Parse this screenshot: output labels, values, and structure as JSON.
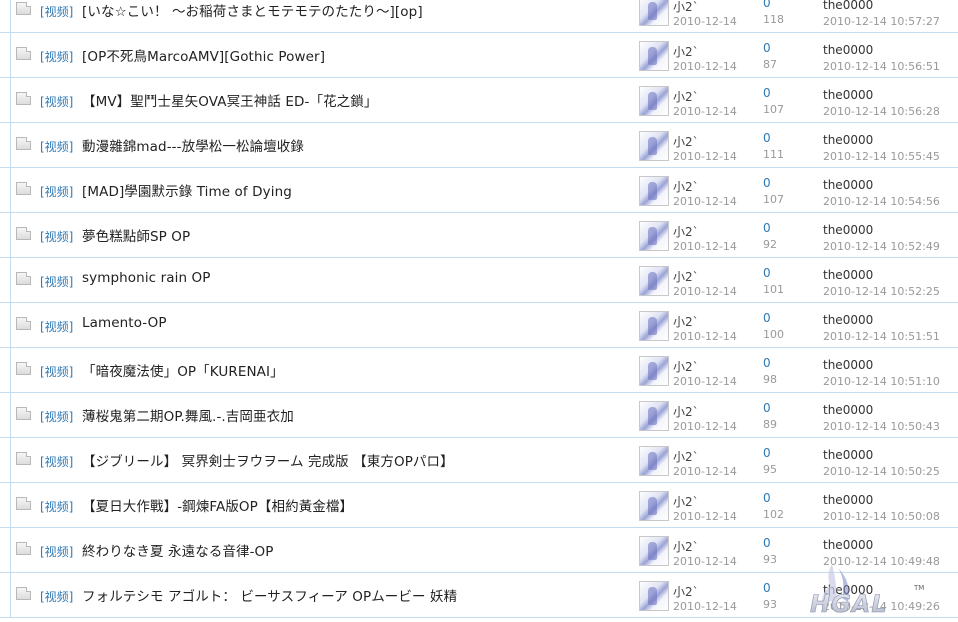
{
  "threads": [
    {
      "type": "[视频]",
      "subject": "[いな☆こい！ ～お稲荷さまとモテモテのたたり～][op]",
      "author": "小2`",
      "date": "2010-12-14",
      "replies": "0",
      "views": "118",
      "lastposter": "the0000",
      "lastdate": "2010-12-14 10:57:27"
    },
    {
      "type": "[视频]",
      "subject": "[OP不死鳥MarcoAMV][Gothic Power]",
      "author": "小2`",
      "date": "2010-12-14",
      "replies": "0",
      "views": "87",
      "lastposter": "the0000",
      "lastdate": "2010-12-14 10:56:51"
    },
    {
      "type": "[视频]",
      "subject": "【MV】聖鬥士星矢OVA冥王神話 ED-「花之鎖」",
      "author": "小2`",
      "date": "2010-12-14",
      "replies": "0",
      "views": "107",
      "lastposter": "the0000",
      "lastdate": "2010-12-14 10:56:28"
    },
    {
      "type": "[视频]",
      "subject": "動漫雜錦mad---放學松一松論壇收錄",
      "author": "小2`",
      "date": "2010-12-14",
      "replies": "0",
      "views": "111",
      "lastposter": "the0000",
      "lastdate": "2010-12-14 10:55:45"
    },
    {
      "type": "[视频]",
      "subject": "[MAD]學園默示錄 Time of Dying",
      "author": "小2`",
      "date": "2010-12-14",
      "replies": "0",
      "views": "107",
      "lastposter": "the0000",
      "lastdate": "2010-12-14 10:54:56"
    },
    {
      "type": "[视频]",
      "subject": "夢色糕點師SP OP",
      "author": "小2`",
      "date": "2010-12-14",
      "replies": "0",
      "views": "92",
      "lastposter": "the0000",
      "lastdate": "2010-12-14 10:52:49"
    },
    {
      "type": "[视频]",
      "subject": "symphonic rain OP",
      "author": "小2`",
      "date": "2010-12-14",
      "replies": "0",
      "views": "101",
      "lastposter": "the0000",
      "lastdate": "2010-12-14 10:52:25"
    },
    {
      "type": "[视频]",
      "subject": "Lamento-OP",
      "author": "小2`",
      "date": "2010-12-14",
      "replies": "0",
      "views": "100",
      "lastposter": "the0000",
      "lastdate": "2010-12-14 10:51:51"
    },
    {
      "type": "[视频]",
      "subject": "「暗夜魔法使」OP「KURENAI」",
      "author": "小2`",
      "date": "2010-12-14",
      "replies": "0",
      "views": "98",
      "lastposter": "the0000",
      "lastdate": "2010-12-14 10:51:10"
    },
    {
      "type": "[视频]",
      "subject": "薄桜鬼第二期OP.舞風.-.吉岡亜衣加",
      "author": "小2`",
      "date": "2010-12-14",
      "replies": "0",
      "views": "89",
      "lastposter": "the0000",
      "lastdate": "2010-12-14 10:50:43"
    },
    {
      "type": "[视频]",
      "subject": "【ジブリール】 冥界剣士ヲウヲーム 完成版 【東方OPパロ】",
      "author": "小2`",
      "date": "2010-12-14",
      "replies": "0",
      "views": "95",
      "lastposter": "the0000",
      "lastdate": "2010-12-14 10:50:25"
    },
    {
      "type": "[视频]",
      "subject": "【夏日大作戰】-鋼煉FA版OP【相約黃金檔】",
      "author": "小2`",
      "date": "2010-12-14",
      "replies": "0",
      "views": "102",
      "lastposter": "the0000",
      "lastdate": "2010-12-14 10:50:08"
    },
    {
      "type": "[视频]",
      "subject": "終わりなき夏 永遠なる音律-OP",
      "author": "小2`",
      "date": "2010-12-14",
      "replies": "0",
      "views": "93",
      "lastposter": "the0000",
      "lastdate": "2010-12-14 10:49:48"
    },
    {
      "type": "[视频]",
      "subject": "フォルテシモ アゴルト： ビーサスフィーア OPムービー 妖精",
      "author": "小2`",
      "date": "2010-12-14",
      "replies": "0",
      "views": "93",
      "lastposter": "the0000",
      "lastdate": "2010-12-14 10:49:26"
    }
  ],
  "watermark": {
    "text": "HGAL",
    "tm": "TM"
  }
}
